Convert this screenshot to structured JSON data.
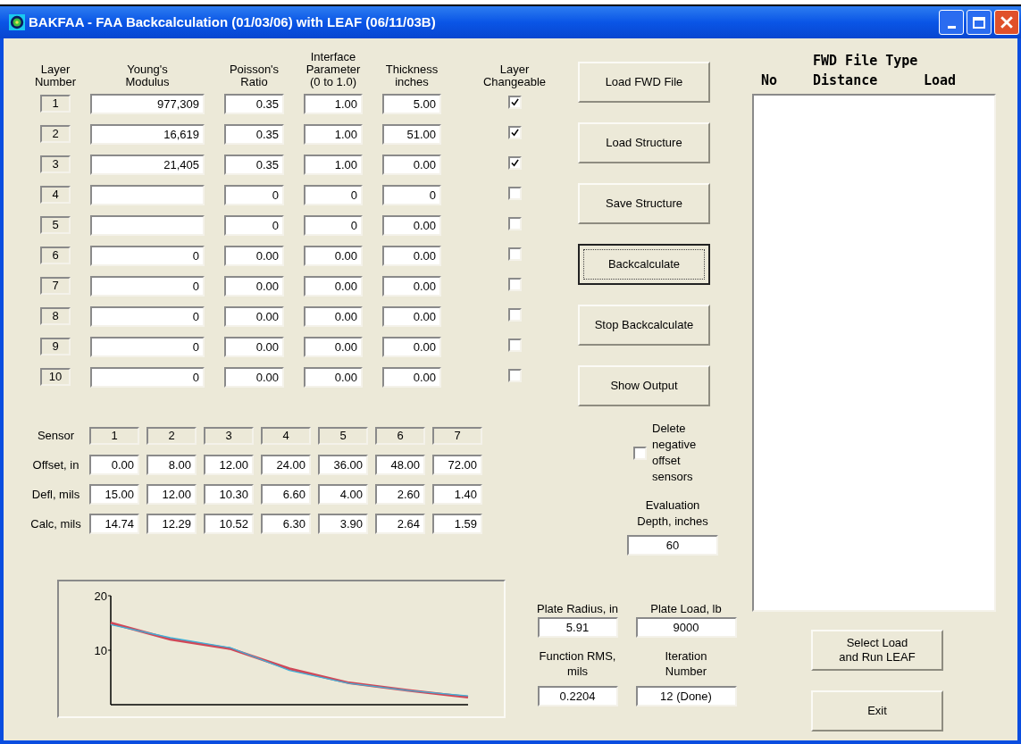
{
  "window": {
    "title": "BAKFAA - FAA Backcalculation (01/03/06) with LEAF (06/11/03B)"
  },
  "layer_table": {
    "columns": [
      "Layer\nNumber",
      "Young's\nModulus",
      "Poisson's\nRatio",
      "Interface\nParameter\n(0 to 1.0)",
      "Thickness\ninches",
      "Layer\nChangeable"
    ],
    "rows": [
      {
        "number": "1",
        "modulus": "977,309",
        "poisson": "0.35",
        "interface": "1.00",
        "thickness": "5.00",
        "changeable": true
      },
      {
        "number": "2",
        "modulus": "16,619",
        "poisson": "0.35",
        "interface": "1.00",
        "thickness": "51.00",
        "changeable": true
      },
      {
        "number": "3",
        "modulus": "21,405",
        "poisson": "0.35",
        "interface": "1.00",
        "thickness": "0.00",
        "changeable": true
      },
      {
        "number": "4",
        "modulus": "",
        "poisson": "0",
        "interface": "0",
        "thickness": "0",
        "changeable": false
      },
      {
        "number": "5",
        "modulus": "",
        "poisson": "0",
        "interface": "0",
        "thickness": "0.00",
        "changeable": false
      },
      {
        "number": "6",
        "modulus": "0",
        "poisson": "0.00",
        "interface": "0.00",
        "thickness": "0.00",
        "changeable": false
      },
      {
        "number": "7",
        "modulus": "0",
        "poisson": "0.00",
        "interface": "0.00",
        "thickness": "0.00",
        "changeable": false
      },
      {
        "number": "8",
        "modulus": "0",
        "poisson": "0.00",
        "interface": "0.00",
        "thickness": "0.00",
        "changeable": false
      },
      {
        "number": "9",
        "modulus": "0",
        "poisson": "0.00",
        "interface": "0.00",
        "thickness": "0.00",
        "changeable": false
      },
      {
        "number": "10",
        "modulus": "0",
        "poisson": "0.00",
        "interface": "0.00",
        "thickness": "0.00",
        "changeable": false
      }
    ]
  },
  "buttons": [
    {
      "label": "Load FWD File",
      "focused": false
    },
    {
      "label": "Load Structure",
      "focused": false
    },
    {
      "label": "Save Structure",
      "focused": false
    },
    {
      "label": "Backcalculate",
      "focused": true
    },
    {
      "label": "Stop Backcalculate",
      "focused": false
    },
    {
      "label": "Show Output",
      "focused": false
    }
  ],
  "sensors": [
    {
      "label": "Sensor",
      "kind": "header",
      "cells": [
        "1",
        "2",
        "3",
        "4",
        "5",
        "6",
        "7"
      ]
    },
    {
      "label": "Offset, in",
      "kind": "value",
      "cells": [
        "0.00",
        "8.00",
        "12.00",
        "24.00",
        "36.00",
        "48.00",
        "72.00"
      ]
    },
    {
      "label": "Defl, mils",
      "kind": "value",
      "cells": [
        "15.00",
        "12.00",
        "10.30",
        "6.60",
        "4.00",
        "2.60",
        "1.40"
      ]
    },
    {
      "label": "Calc, mils",
      "kind": "value",
      "cells": [
        "14.74",
        "12.29",
        "10.52",
        "6.30",
        "3.90",
        "2.64",
        "1.59"
      ]
    }
  ],
  "delete_negative": {
    "label": "Delete\nnegative\noffset\nsensors",
    "checked": false
  },
  "evaluation_depth": {
    "label": "Evaluation\nDepth, inches",
    "value": "60"
  },
  "plate_fields": [
    {
      "label": "Plate Radius, in",
      "value": "5.91"
    },
    {
      "label": "Plate Load, lb",
      "value": "9000"
    },
    {
      "label": "Function RMS,\nmils",
      "value": "0.2204"
    },
    {
      "label": "Iteration\nNumber",
      "value": "12 (Done)"
    }
  ],
  "fwd_list": {
    "title": "FWD File Type",
    "columns": [
      "No",
      "Distance",
      "Load"
    ]
  },
  "bottom_buttons": [
    {
      "label": "Select Load\nand Run LEAF"
    },
    {
      "label": "Exit"
    }
  ],
  "chart": {
    "chart_data": {
      "type": "line",
      "ylim": [
        0,
        20
      ],
      "yticks": [
        10,
        20
      ],
      "series": [
        {
          "color": "#d04858",
          "values": [
            15.0,
            12.0,
            10.3,
            6.6,
            4.0,
            2.6,
            1.4
          ]
        },
        {
          "color": "#3fb0d8",
          "values": [
            14.7,
            12.3,
            10.5,
            6.3,
            3.9,
            2.6,
            1.6
          ]
        }
      ]
    }
  }
}
